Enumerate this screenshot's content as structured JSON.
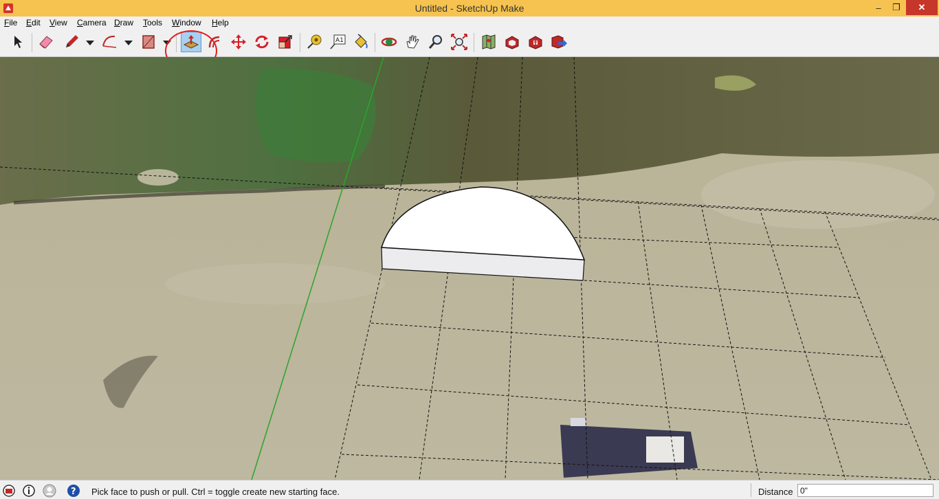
{
  "window": {
    "title": "Untitled - SketchUp Make",
    "minimize": "–",
    "maximize": "❐",
    "close": "✕"
  },
  "menu": [
    "File",
    "Edit",
    "View",
    "Camera",
    "Draw",
    "Tools",
    "Window",
    "Help"
  ],
  "toolbar": {
    "selected_tool": "push-pull",
    "tools": [
      "select",
      "eraser",
      "pencil",
      "arc",
      "rectangle",
      "push-pull",
      "offset",
      "move",
      "rotate",
      "scale",
      "tape-measure",
      "text",
      "paint-bucket",
      "orbit",
      "pan",
      "zoom",
      "zoom-extents",
      "add-location",
      "3d-warehouse",
      "extension-warehouse",
      "share-model"
    ]
  },
  "status": {
    "hint": "Pick face to push or pull.  Ctrl = toggle create new starting face.",
    "measurement_label": "Distance",
    "measurement_value": "0\""
  },
  "colors": {
    "titlebar": "#f6c350",
    "close_button": "#c7362a",
    "highlight_ring": "#e02020",
    "green_axis": "#2aa42a",
    "selected_tool_bg": "#a9cff0"
  }
}
